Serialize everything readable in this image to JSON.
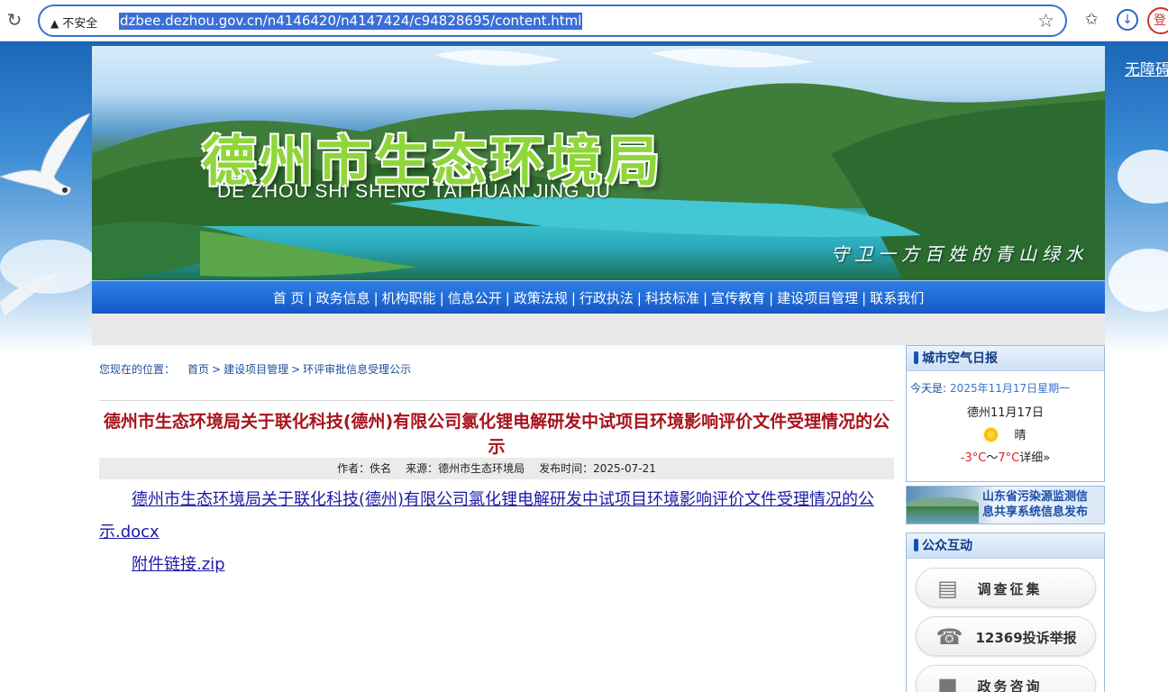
{
  "browser": {
    "security_label": "不安全",
    "url": "dzbee.dezhou.gov.cn/n4146420/n4147424/c94828695/content.html",
    "profile_label": "登"
  },
  "header": {
    "accessibility_link": "无障碍",
    "site_title": "德州市生态环境局",
    "site_pinyin": "DE ZHOU SHI SHENG TAI HUAN JING JU",
    "slogan": "守卫一方百姓的青山绿水"
  },
  "nav": {
    "items": [
      "首 页",
      "政务信息",
      "机构职能",
      "信息公开",
      "政策法规",
      "行政执法",
      "科技标准",
      "宣传教育",
      "建设项目管理",
      "联系我们"
    ]
  },
  "breadcrumb": {
    "label": "您现在的位置：",
    "items": [
      "首页",
      "建设项目管理",
      "环评审批信息受理公示"
    ]
  },
  "article": {
    "title": "德州市生态环境局关于联化科技(德州)有限公司氯化锂电解研发中试项目环境影响评价文件受理情况的公示",
    "author": "作者：佚名",
    "source": "来源：德州市生态环境局",
    "published": "发布时间：2025-07-21",
    "attachments": [
      "德州市生态环境局关于联化科技(德州)有限公司氯化锂电解研发中试项目环境影响评价文件受理情况的公示.docx",
      "附件链接.zip"
    ]
  },
  "sidebar": {
    "air_report": {
      "title": "城市空气日报",
      "today_label": "今天是:",
      "today_date": "2025年11月17日星期一",
      "city_date": "德州11月17日",
      "weather_icon": "sun-icon",
      "weather": "晴",
      "temp_low": "-3°C",
      "temp_sep": "～",
      "temp_high": "7°C",
      "detail_link": "详细»"
    },
    "pollution_banner": {
      "line1": "山东省污染源监测信",
      "line2": "息共享系统信息发布"
    },
    "interaction": {
      "title": "公众互动",
      "buttons": [
        {
          "icon": "document-icon",
          "label": "调查征集"
        },
        {
          "icon": "telephone-icon",
          "label": "12369投诉举报"
        },
        {
          "icon": "consult-icon",
          "label": "政务咨询"
        }
      ]
    }
  }
}
